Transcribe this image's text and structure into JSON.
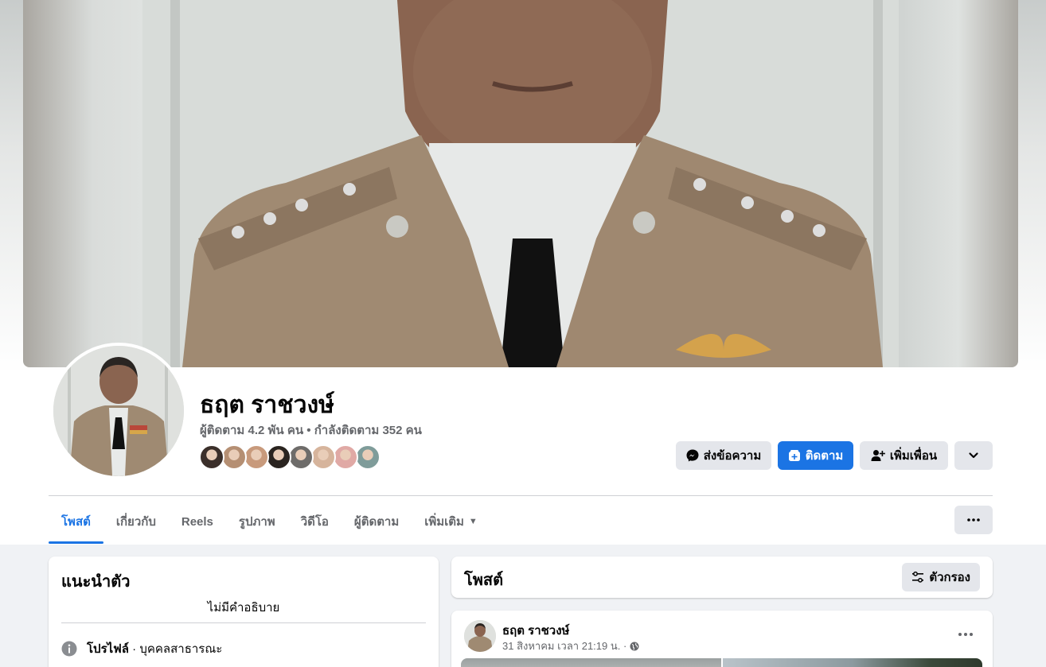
{
  "profile": {
    "name": "ธฤต ราชวงษ์",
    "followers_text": "ผู้ติดตาม 4.2 พัน คน",
    "separator": "•",
    "following_text": "กำลังติดตาม 352 คน",
    "friend_avatar_colors": [
      "#3b2f2a",
      "#b58f73",
      "#c89a7c",
      "#2a2420",
      "#6e6c6a",
      "#d6b49c",
      "#e0a9a5",
      "#7f9c9a"
    ]
  },
  "actions": {
    "message_label": "ส่งข้อความ",
    "follow_label": "ติดตาม",
    "add_friend_label": "เพิ่มเพื่อน"
  },
  "tabs": [
    {
      "label": "โพสต์"
    },
    {
      "label": "เกี่ยวกับ"
    },
    {
      "label": "Reels"
    },
    {
      "label": "รูปภาพ"
    },
    {
      "label": "วิดีโอ"
    },
    {
      "label": "ผู้ติดตาม"
    },
    {
      "label": "เพิ่มเติม"
    }
  ],
  "intro": {
    "title": "แนะนำตัว",
    "bio": "ไม่มีคำอธิบาย",
    "profile_label": "โปรไฟล์",
    "profile_type": " · บุคคลสาธารณะ"
  },
  "posts": {
    "title": "โพสต์",
    "filter_label": "ตัวกรอง",
    "first": {
      "author": "ธฤต ราชวงษ์",
      "date": "31 สิงหาคม เวลา 21:19 น. ·"
    }
  },
  "colors": {
    "accent": "#1b74e4",
    "button_gray": "#e4e6eb",
    "page_bg": "#f0f2f5"
  }
}
